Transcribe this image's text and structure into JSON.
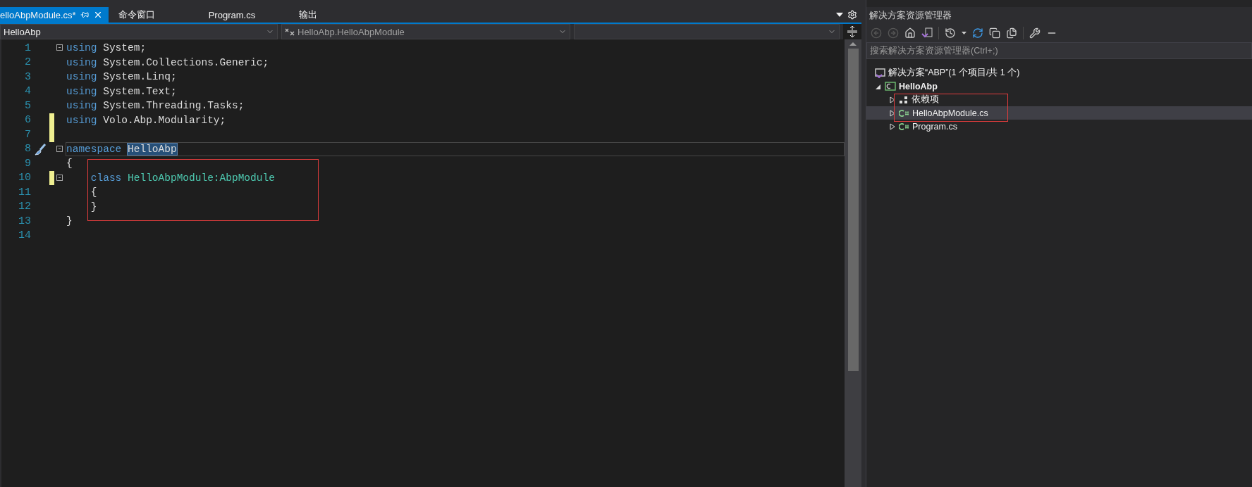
{
  "tabs": [
    {
      "label": "elloAbpModule.cs*",
      "selected": true
    },
    {
      "label": "命令窗口",
      "selected": false
    },
    {
      "label": "Program.cs",
      "selected": false
    },
    {
      "label": "输出",
      "selected": false
    }
  ],
  "navigation": {
    "project": "HelloAbp",
    "type": "HelloAbp.HelloAbpModule"
  },
  "editor": {
    "lines": [
      {
        "number": "1",
        "foldable": true,
        "changed": false,
        "current": false,
        "tokens": [
          {
            "text": "using",
            "kind": "keyword"
          },
          {
            "text": " System;",
            "kind": "text"
          }
        ]
      },
      {
        "number": "2",
        "foldable": false,
        "changed": false,
        "current": false,
        "tokens": [
          {
            "text": "using",
            "kind": "keyword"
          },
          {
            "text": " System.Collections.Generic;",
            "kind": "text"
          }
        ]
      },
      {
        "number": "3",
        "foldable": false,
        "changed": false,
        "current": false,
        "tokens": [
          {
            "text": "using",
            "kind": "keyword"
          },
          {
            "text": " System.Linq;",
            "kind": "text"
          }
        ]
      },
      {
        "number": "4",
        "foldable": false,
        "changed": false,
        "current": false,
        "tokens": [
          {
            "text": "using",
            "kind": "keyword"
          },
          {
            "text": " System.Text;",
            "kind": "text"
          }
        ]
      },
      {
        "number": "5",
        "foldable": false,
        "changed": false,
        "current": false,
        "tokens": [
          {
            "text": "using",
            "kind": "keyword"
          },
          {
            "text": " System.Threading.Tasks;",
            "kind": "text"
          }
        ]
      },
      {
        "number": "6",
        "foldable": false,
        "changed": true,
        "current": false,
        "tokens": [
          {
            "text": "using",
            "kind": "keyword"
          },
          {
            "text": " Volo.Abp.Modularity;",
            "kind": "text"
          }
        ]
      },
      {
        "number": "7",
        "foldable": false,
        "changed": true,
        "current": false
      },
      {
        "number": "8",
        "foldable": true,
        "changed": false,
        "current": true,
        "tokens": [
          {
            "text": "namespace ",
            "kind": "keyword"
          },
          {
            "text": "HelloAbp",
            "kind": "selection"
          }
        ]
      },
      {
        "number": "9",
        "foldable": false,
        "changed": false,
        "current": false,
        "tokens": [
          {
            "text": "{",
            "kind": "text"
          }
        ]
      },
      {
        "number": "10",
        "foldable": true,
        "changed": true,
        "current": false,
        "tokens": [
          {
            "text": "    class",
            "kind": "keyword"
          },
          {
            "text": " HelloAbpModule:AbpModule",
            "kind": "type"
          }
        ]
      },
      {
        "number": "11",
        "foldable": false,
        "changed": false,
        "current": false,
        "tokens": [
          {
            "text": "    {",
            "kind": "text"
          }
        ]
      },
      {
        "number": "12",
        "foldable": false,
        "changed": false,
        "current": false,
        "tokens": [
          {
            "text": "    }",
            "kind": "text"
          }
        ]
      },
      {
        "number": "13",
        "foldable": false,
        "changed": false,
        "current": false,
        "tokens": [
          {
            "text": "}",
            "kind": "text"
          }
        ]
      },
      {
        "number": "14",
        "foldable": false,
        "changed": false,
        "current": false
      }
    ]
  },
  "solution_explorer": {
    "title": "解决方案资源管理器",
    "search": {
      "placeholder": "搜索解决方案资源管理器(Ctrl+;)"
    },
    "tree": [
      {
        "label": "解决方案“ABP”(1 个项目/共 1 个)",
        "kind": "solution",
        "selected": false,
        "children": [
          {
            "label": "HelloAbp",
            "kind": "project",
            "expanded": true,
            "selected": false,
            "children": [
              {
                "label": "依赖项",
                "kind": "dependencies",
                "expanded": false,
                "selected": false
              },
              {
                "label": "HelloAbpModule.cs",
                "kind": "csharp",
                "expanded": false,
                "selected": true
              },
              {
                "label": "Program.cs",
                "kind": "csharp",
                "expanded": false,
                "selected": false
              }
            ]
          }
        ]
      }
    ]
  }
}
